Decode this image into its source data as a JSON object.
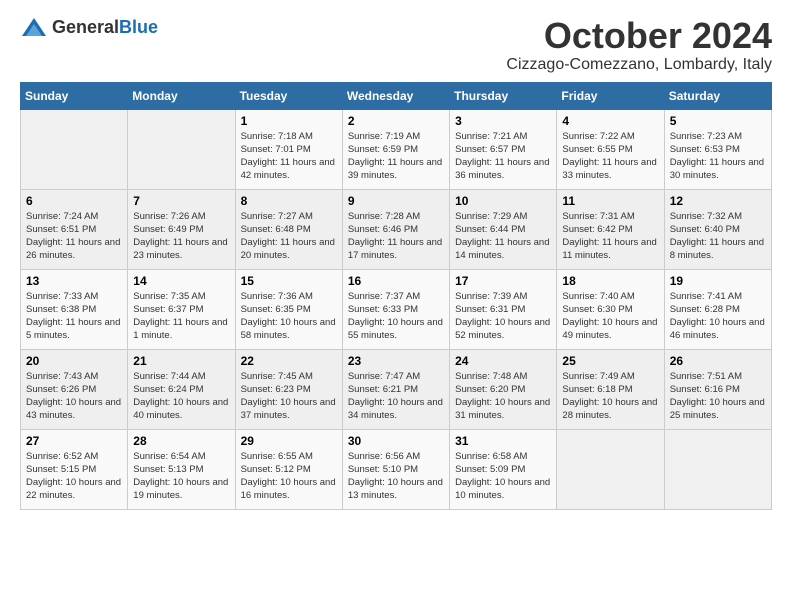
{
  "header": {
    "logo_general": "General",
    "logo_blue": "Blue",
    "month_title": "October 2024",
    "location": "Cizzago-Comezzano, Lombardy, Italy"
  },
  "days_of_week": [
    "Sunday",
    "Monday",
    "Tuesday",
    "Wednesday",
    "Thursday",
    "Friday",
    "Saturday"
  ],
  "weeks": [
    [
      {
        "day": "",
        "info": ""
      },
      {
        "day": "",
        "info": ""
      },
      {
        "day": "1",
        "info": "Sunrise: 7:18 AM\nSunset: 7:01 PM\nDaylight: 11 hours and 42 minutes."
      },
      {
        "day": "2",
        "info": "Sunrise: 7:19 AM\nSunset: 6:59 PM\nDaylight: 11 hours and 39 minutes."
      },
      {
        "day": "3",
        "info": "Sunrise: 7:21 AM\nSunset: 6:57 PM\nDaylight: 11 hours and 36 minutes."
      },
      {
        "day": "4",
        "info": "Sunrise: 7:22 AM\nSunset: 6:55 PM\nDaylight: 11 hours and 33 minutes."
      },
      {
        "day": "5",
        "info": "Sunrise: 7:23 AM\nSunset: 6:53 PM\nDaylight: 11 hours and 30 minutes."
      }
    ],
    [
      {
        "day": "6",
        "info": "Sunrise: 7:24 AM\nSunset: 6:51 PM\nDaylight: 11 hours and 26 minutes."
      },
      {
        "day": "7",
        "info": "Sunrise: 7:26 AM\nSunset: 6:49 PM\nDaylight: 11 hours and 23 minutes."
      },
      {
        "day": "8",
        "info": "Sunrise: 7:27 AM\nSunset: 6:48 PM\nDaylight: 11 hours and 20 minutes."
      },
      {
        "day": "9",
        "info": "Sunrise: 7:28 AM\nSunset: 6:46 PM\nDaylight: 11 hours and 17 minutes."
      },
      {
        "day": "10",
        "info": "Sunrise: 7:29 AM\nSunset: 6:44 PM\nDaylight: 11 hours and 14 minutes."
      },
      {
        "day": "11",
        "info": "Sunrise: 7:31 AM\nSunset: 6:42 PM\nDaylight: 11 hours and 11 minutes."
      },
      {
        "day": "12",
        "info": "Sunrise: 7:32 AM\nSunset: 6:40 PM\nDaylight: 11 hours and 8 minutes."
      }
    ],
    [
      {
        "day": "13",
        "info": "Sunrise: 7:33 AM\nSunset: 6:38 PM\nDaylight: 11 hours and 5 minutes."
      },
      {
        "day": "14",
        "info": "Sunrise: 7:35 AM\nSunset: 6:37 PM\nDaylight: 11 hours and 1 minute."
      },
      {
        "day": "15",
        "info": "Sunrise: 7:36 AM\nSunset: 6:35 PM\nDaylight: 10 hours and 58 minutes."
      },
      {
        "day": "16",
        "info": "Sunrise: 7:37 AM\nSunset: 6:33 PM\nDaylight: 10 hours and 55 minutes."
      },
      {
        "day": "17",
        "info": "Sunrise: 7:39 AM\nSunset: 6:31 PM\nDaylight: 10 hours and 52 minutes."
      },
      {
        "day": "18",
        "info": "Sunrise: 7:40 AM\nSunset: 6:30 PM\nDaylight: 10 hours and 49 minutes."
      },
      {
        "day": "19",
        "info": "Sunrise: 7:41 AM\nSunset: 6:28 PM\nDaylight: 10 hours and 46 minutes."
      }
    ],
    [
      {
        "day": "20",
        "info": "Sunrise: 7:43 AM\nSunset: 6:26 PM\nDaylight: 10 hours and 43 minutes."
      },
      {
        "day": "21",
        "info": "Sunrise: 7:44 AM\nSunset: 6:24 PM\nDaylight: 10 hours and 40 minutes."
      },
      {
        "day": "22",
        "info": "Sunrise: 7:45 AM\nSunset: 6:23 PM\nDaylight: 10 hours and 37 minutes."
      },
      {
        "day": "23",
        "info": "Sunrise: 7:47 AM\nSunset: 6:21 PM\nDaylight: 10 hours and 34 minutes."
      },
      {
        "day": "24",
        "info": "Sunrise: 7:48 AM\nSunset: 6:20 PM\nDaylight: 10 hours and 31 minutes."
      },
      {
        "day": "25",
        "info": "Sunrise: 7:49 AM\nSunset: 6:18 PM\nDaylight: 10 hours and 28 minutes."
      },
      {
        "day": "26",
        "info": "Sunrise: 7:51 AM\nSunset: 6:16 PM\nDaylight: 10 hours and 25 minutes."
      }
    ],
    [
      {
        "day": "27",
        "info": "Sunrise: 6:52 AM\nSunset: 5:15 PM\nDaylight: 10 hours and 22 minutes."
      },
      {
        "day": "28",
        "info": "Sunrise: 6:54 AM\nSunset: 5:13 PM\nDaylight: 10 hours and 19 minutes."
      },
      {
        "day": "29",
        "info": "Sunrise: 6:55 AM\nSunset: 5:12 PM\nDaylight: 10 hours and 16 minutes."
      },
      {
        "day": "30",
        "info": "Sunrise: 6:56 AM\nSunset: 5:10 PM\nDaylight: 10 hours and 13 minutes."
      },
      {
        "day": "31",
        "info": "Sunrise: 6:58 AM\nSunset: 5:09 PM\nDaylight: 10 hours and 10 minutes."
      },
      {
        "day": "",
        "info": ""
      },
      {
        "day": "",
        "info": ""
      }
    ]
  ]
}
